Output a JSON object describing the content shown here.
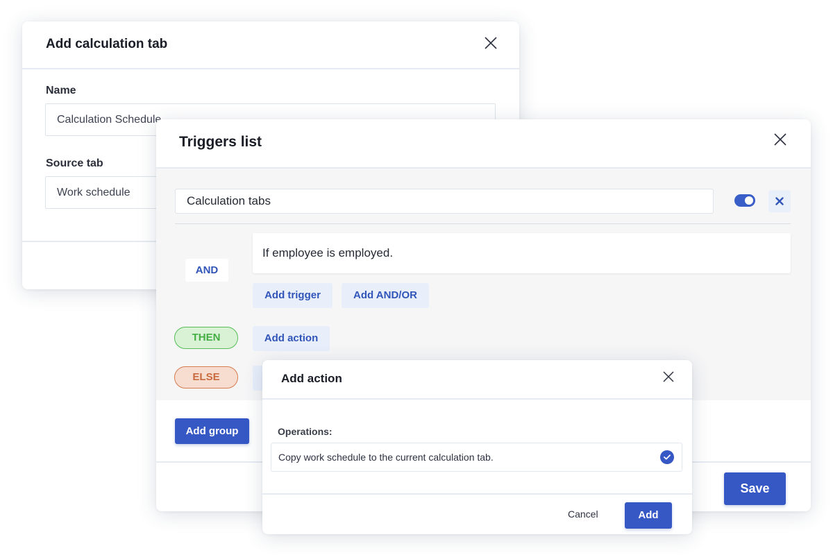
{
  "calc_dialog": {
    "title": "Add calculation tab",
    "name_label": "Name",
    "name_value": "Calculation Schedule",
    "source_label": "Source tab",
    "source_value": "Work schedule"
  },
  "triggers_dialog": {
    "title": "Triggers list",
    "group_name": "Calculation tabs",
    "toggle_on": true,
    "and_label": "AND",
    "condition": "If employee is employed.",
    "add_trigger_label": "Add trigger",
    "add_and_or_label": "Add AND/OR",
    "then_label": "THEN",
    "add_action_label": "Add action",
    "else_label": "ELSE",
    "add_group_label": "Add group",
    "save_label": "Save"
  },
  "action_dialog": {
    "title": "Add action",
    "operations_label": "Operations:",
    "operations": [
      {
        "label": "Copy work schedule to the current calculation tab.",
        "selected": true
      }
    ],
    "cancel_label": "Cancel",
    "add_label": "Add"
  },
  "colors": {
    "primary": "#3658c5",
    "then_green": "#44ae44",
    "else_orange": "#c96a3e"
  },
  "icons": {
    "close": "close-icon",
    "remove": "remove-icon",
    "check": "check-icon",
    "toggle": "toggle-switch"
  }
}
